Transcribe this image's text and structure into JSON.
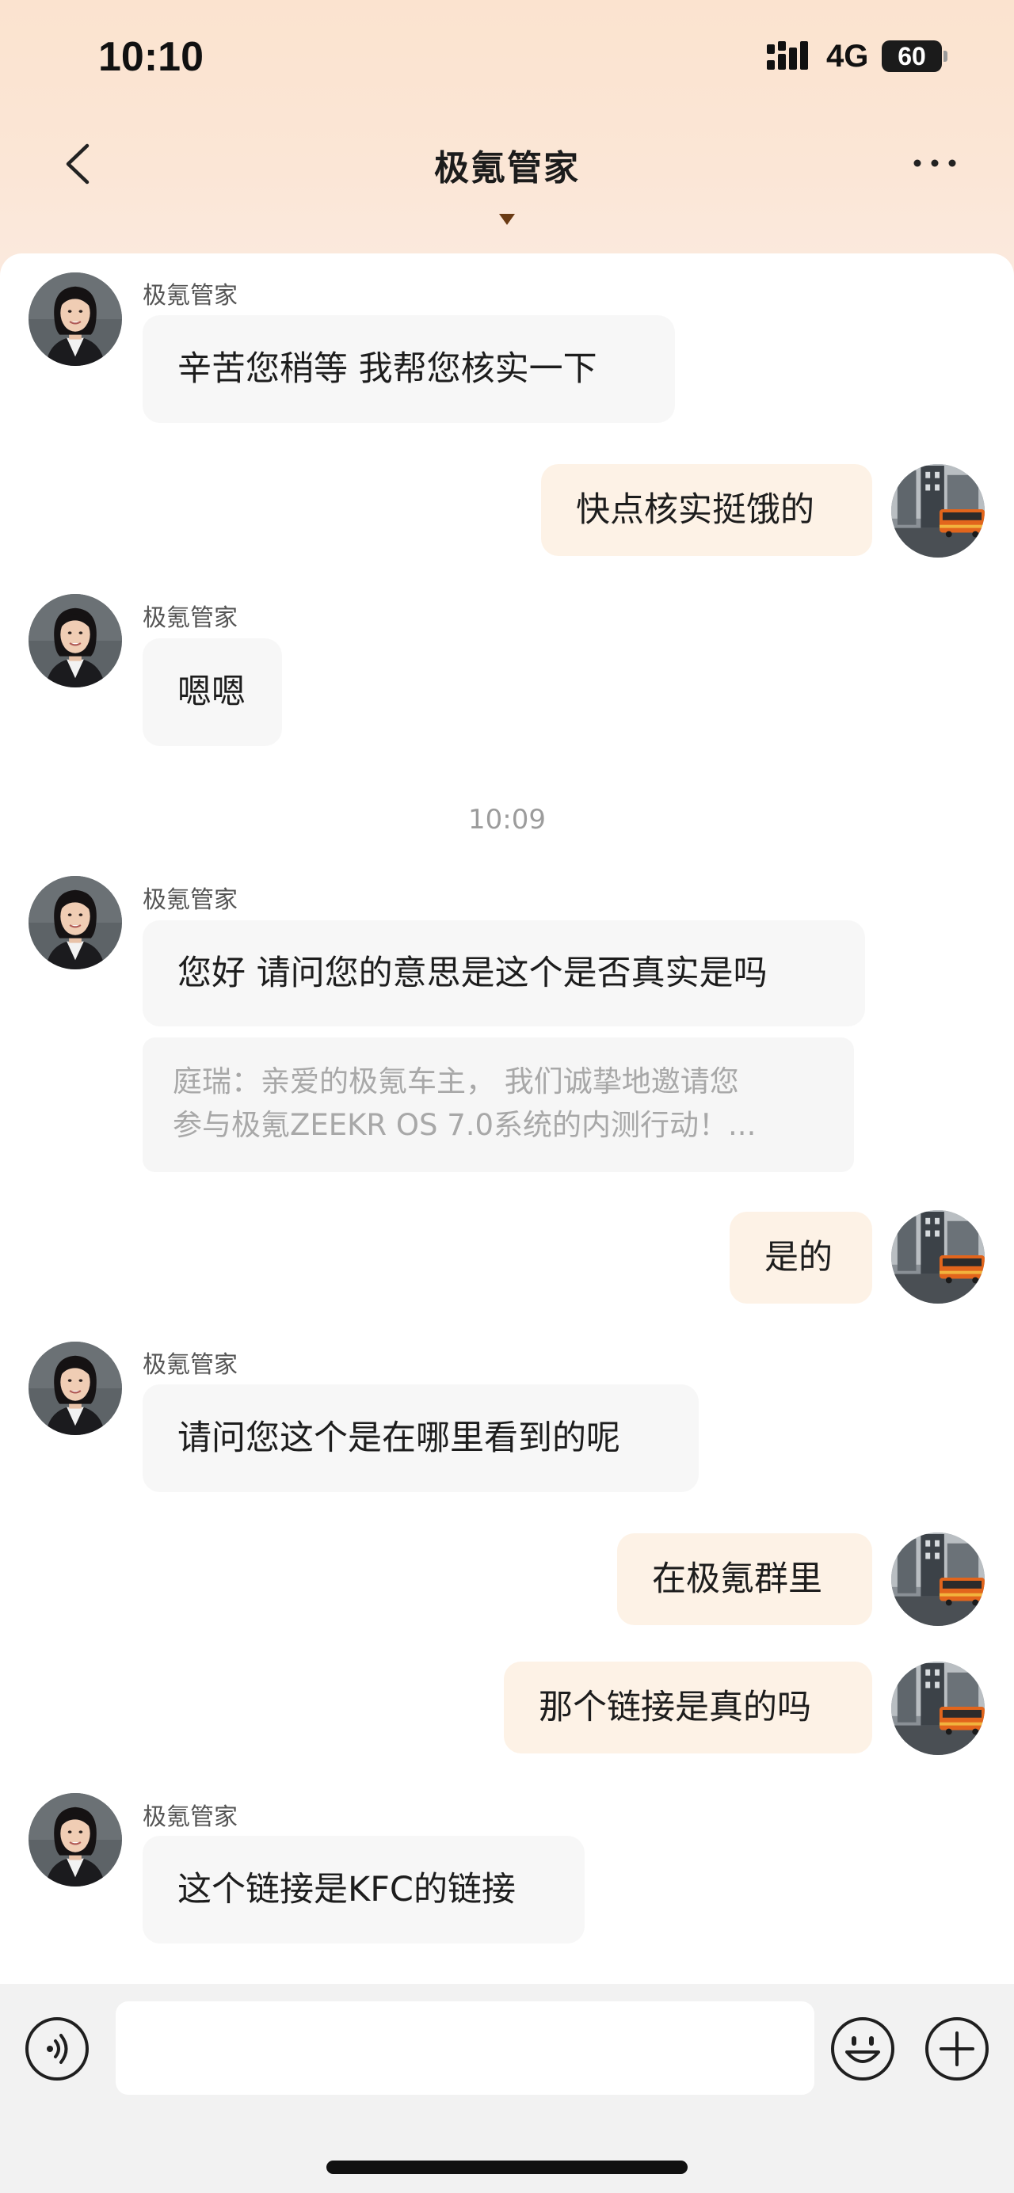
{
  "status_bar": {
    "time": "10:10",
    "network": "4G",
    "battery": "60"
  },
  "header": {
    "title": "极氪管家"
  },
  "chat": {
    "messages": [
      {
        "sender": "极氪管家",
        "text": "辛苦您稍等 我帮您核实一下"
      },
      {
        "text": "快点核实挺饿的"
      },
      {
        "sender": "极氪管家",
        "text": "嗯嗯"
      },
      {
        "timestamp": "10:09"
      },
      {
        "sender": "极氪管家",
        "text": "您好 请问您的意思是这个是否真实是吗",
        "quote": [
          "庭瑞：亲爱的极氪车主， 我们诚挚地邀请您",
          "参与极氪ZEEKR OS 7.0系统的内测行动！..."
        ]
      },
      {
        "text": "是的"
      },
      {
        "sender": "极氪管家",
        "text": "请问您这个是在哪里看到的呢"
      },
      {
        "text": "在极氪群里"
      },
      {
        "text": "那个链接是真的吗"
      },
      {
        "sender": "极氪管家",
        "text": "这个链接是KFC的链接"
      }
    ]
  },
  "input_bar": {
    "voice_icon": "voice-icon",
    "emoji_icon": "emoji-icon",
    "plus_icon": "plus-icon"
  },
  "colors": {
    "incoming_bubble": "#f7f7f7",
    "outgoing_bubble": "#fdf2e6",
    "header_gradient": "#fbe3cf"
  }
}
